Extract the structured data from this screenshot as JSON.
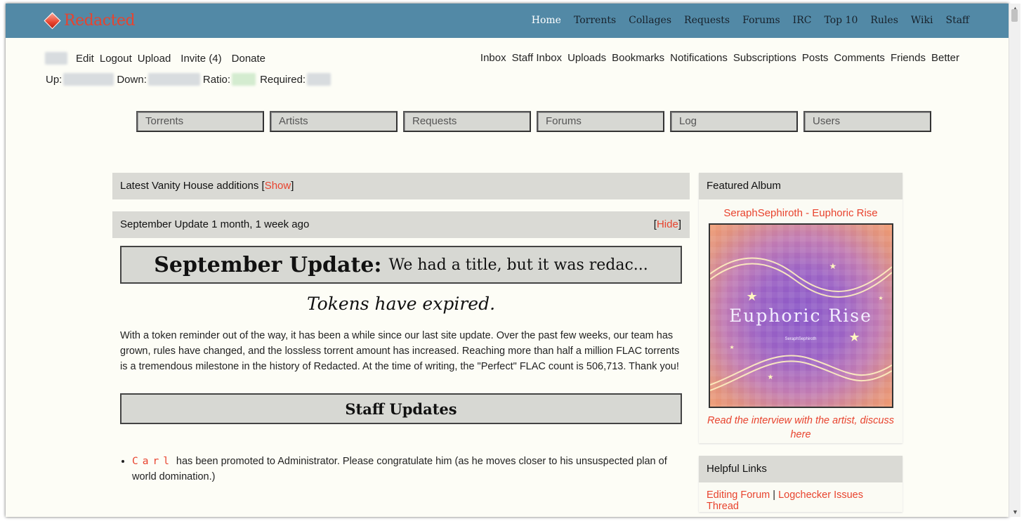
{
  "site": {
    "logo_text": "Redacted",
    "brand_color": "#e8432e",
    "topbar_color": "#5289a6"
  },
  "topnav": [
    {
      "label": "Home",
      "active": true
    },
    {
      "label": "Torrents"
    },
    {
      "label": "Collages"
    },
    {
      "label": "Requests"
    },
    {
      "label": "Forums"
    },
    {
      "label": "IRC"
    },
    {
      "label": "Top 10"
    },
    {
      "label": "Rules"
    },
    {
      "label": "Wiki"
    },
    {
      "label": "Staff"
    }
  ],
  "user_menu": {
    "edit": "Edit",
    "logout": "Logout",
    "upload": "Upload",
    "invite": "Invite (4)",
    "donate": "Donate"
  },
  "user_links": [
    "Inbox",
    "Staff Inbox",
    "Uploads",
    "Bookmarks",
    "Notifications",
    "Subscriptions",
    "Posts",
    "Comments",
    "Friends",
    "Better"
  ],
  "stats": {
    "up_label": "Up:",
    "down_label": "Down:",
    "ratio_label": "Ratio:",
    "required_label": "Required:"
  },
  "search": [
    "Torrents",
    "Artists",
    "Requests",
    "Forums",
    "Log",
    "Users"
  ],
  "vanity": {
    "label": "Latest Vanity House additions [",
    "show": "Show",
    "close": "]"
  },
  "news": {
    "header": "September Update 1 month, 1 week ago",
    "hide_open": "[",
    "hide": "Hide",
    "hide_close": "]",
    "title_big": "September Update:",
    "title_small": "We had a title, but it was redac...",
    "tokens": "Tokens have expired.",
    "paragraph": "With a token reminder out of the way, it has been a while since our last site update. Over the past few weeks, our team has grown, rules have changed, and the lossless torrent amount has increased. Reaching more than half a million FLAC torrents is a tremendous milestone in the history of Redacted. At the time of writing, the \"Perfect\" FLAC count is 506,713. Thank you!",
    "staff_title": "Staff Updates",
    "bullet_user": "Carl",
    "bullet_text": "has been promoted to Administrator. Please congratulate him (as he moves closer to his unsuspected plan of world domination.)"
  },
  "featured": {
    "header": "Featured Album",
    "link": "SeraphSephiroth - Euphoric Rise",
    "album_title": "Euphoric Rise",
    "album_artist": "SeraphSephiroth",
    "caption": "Read the interview with the artist, discuss here"
  },
  "helpful": {
    "header": "Helpful Links",
    "link1": "Editing Forum",
    "sep": " | ",
    "link2": "Logchecker Issues Thread"
  }
}
